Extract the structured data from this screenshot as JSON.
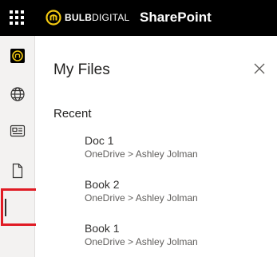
{
  "header": {
    "brand_bold": "BULB",
    "brand_light": "DIGITAL",
    "app_title": "SharePoint",
    "brand_color": "#f2c811"
  },
  "rail": {
    "items": [
      {
        "name": "bulb-digital-app",
        "icon": "bulb-logo-icon"
      },
      {
        "name": "sites",
        "icon": "globe-icon"
      },
      {
        "name": "news",
        "icon": "news-icon"
      },
      {
        "name": "my-files",
        "icon": "file-icon",
        "selected": true
      }
    ],
    "highlight_color": "#e01b24"
  },
  "panel": {
    "title": "My Files",
    "close_icon": "close-icon",
    "section_heading": "Recent",
    "files": [
      {
        "name": "Doc 1",
        "path": "OneDrive > Ashley Jolman"
      },
      {
        "name": "Book 2",
        "path": "OneDrive > Ashley Jolman"
      },
      {
        "name": "Book 1",
        "path": "OneDrive > Ashley Jolman"
      }
    ]
  }
}
